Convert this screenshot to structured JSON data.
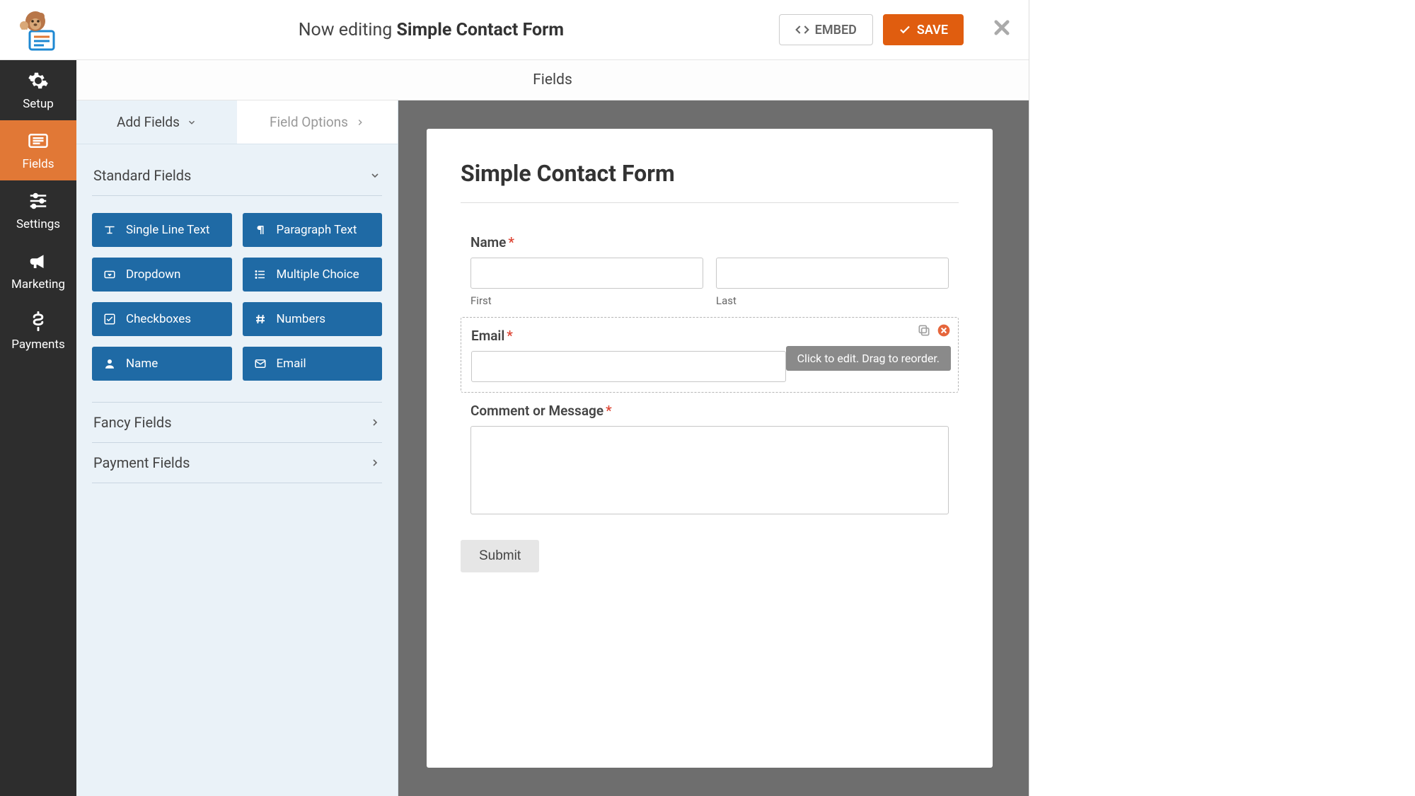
{
  "header": {
    "editing_prefix": "Now editing ",
    "form_name": "Simple Contact Form",
    "embed_label": "EMBED",
    "save_label": "SAVE"
  },
  "subheader": {
    "title": "Fields"
  },
  "nav": {
    "items": [
      {
        "label": "Setup",
        "active": false
      },
      {
        "label": "Fields",
        "active": true
      },
      {
        "label": "Settings",
        "active": false
      },
      {
        "label": "Marketing",
        "active": false
      },
      {
        "label": "Payments",
        "active": false
      }
    ]
  },
  "panel": {
    "tabs": {
      "add": "Add Fields",
      "options": "Field Options"
    },
    "sections": {
      "standard": "Standard Fields",
      "fancy": "Fancy Fields",
      "payment": "Payment Fields"
    },
    "standard_fields": [
      {
        "label": "Single Line Text"
      },
      {
        "label": "Paragraph Text"
      },
      {
        "label": "Dropdown"
      },
      {
        "label": "Multiple Choice"
      },
      {
        "label": "Checkboxes"
      },
      {
        "label": "Numbers"
      },
      {
        "label": "Name"
      },
      {
        "label": "Email"
      }
    ]
  },
  "form": {
    "title": "Simple Contact Form",
    "name": {
      "label": "Name",
      "first": "First",
      "last": "Last"
    },
    "email": {
      "label": "Email"
    },
    "comment": {
      "label": "Comment or Message"
    },
    "submit": "Submit",
    "tooltip": "Click to edit. Drag to reorder."
  }
}
